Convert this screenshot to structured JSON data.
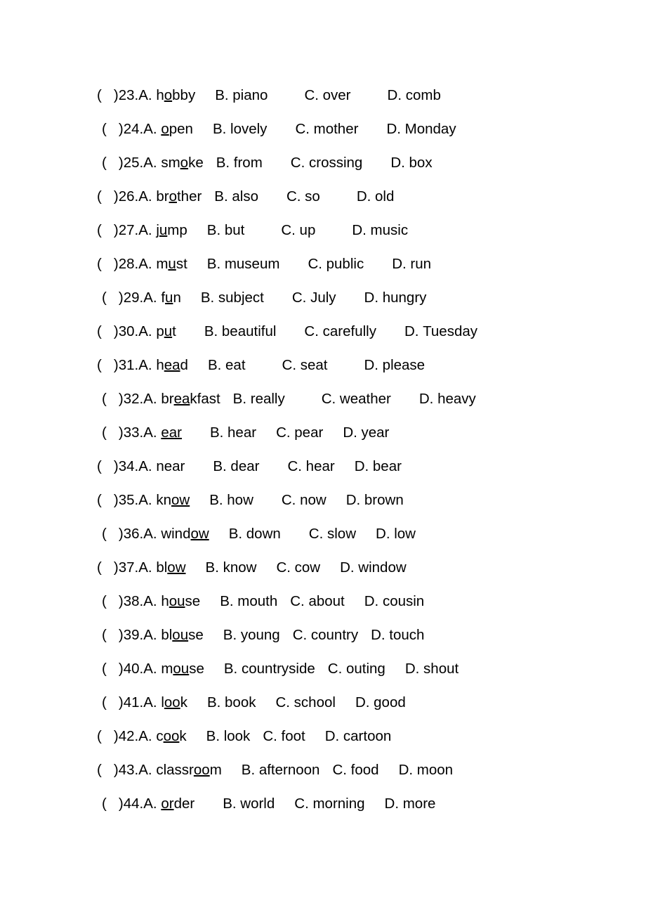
{
  "document": {
    "type": "english-pronunciation-worksheet",
    "bracket_open": "(",
    "bracket_close": ")",
    "option_labels": [
      "A.",
      "B.",
      "C.",
      "D."
    ],
    "questions": [
      {
        "number": "23.",
        "indent": false,
        "a_pre": "h",
        "a_underlined": "o",
        "a_post": "bby",
        "a_full": "hobby",
        "b": "piano",
        "c": "over",
        "d": "comb",
        "gaps": [
          "md",
          "xl",
          "xl"
        ]
      },
      {
        "number": "24.",
        "indent": true,
        "a_pre": "",
        "a_underlined": "o",
        "a_post": "pen",
        "a_full": "open",
        "b": "lovely",
        "c": "mother",
        "d": "Monday",
        "gaps": [
          "md",
          "lg",
          "lg"
        ]
      },
      {
        "number": "25.",
        "indent": true,
        "a_pre": "sm",
        "a_underlined": "o",
        "a_post": "ke",
        "a_full": "smoke",
        "b": "from",
        "c": "crossing",
        "d": "box",
        "gaps": [
          "sm",
          "lg",
          "lg"
        ]
      },
      {
        "number": "26.",
        "indent": false,
        "a_pre": "br",
        "a_underlined": "o",
        "a_post": "ther",
        "a_full": "brother",
        "b": "also",
        "c": "so",
        "d": "old",
        "gaps": [
          "sm",
          "lg",
          "xl"
        ]
      },
      {
        "number": "27.",
        "indent": false,
        "a_pre": "j",
        "a_underlined": "u",
        "a_post": "mp",
        "a_full": "jump",
        "b": "but",
        "c": "up",
        "d": "music",
        "gaps": [
          "md",
          "xl",
          "xl"
        ]
      },
      {
        "number": "28.",
        "indent": false,
        "a_pre": "m",
        "a_underlined": "u",
        "a_post": "st",
        "a_full": "must",
        "b": "museum",
        "c": "public",
        "d": "run",
        "gaps": [
          "md",
          "lg",
          "lg"
        ]
      },
      {
        "number": "29.",
        "indent": true,
        "a_pre": "f",
        "a_underlined": "u",
        "a_post": "n",
        "a_full": "fun",
        "b": "subject",
        "c": "July",
        "d": "hungry",
        "gaps": [
          "md",
          "lg",
          "lg"
        ]
      },
      {
        "number": "30.",
        "indent": false,
        "a_pre": "p",
        "a_underlined": "u",
        "a_post": "t",
        "a_full": "put",
        "b": "beautiful",
        "c": "carefully",
        "d": "Tuesday",
        "gaps": [
          "lg",
          "lg",
          "lg"
        ]
      },
      {
        "number": "31.",
        "indent": false,
        "a_pre": "h",
        "a_underlined": "ea",
        "a_post": "d",
        "a_full": "head",
        "b": "eat",
        "c": "seat",
        "d": "please",
        "gaps": [
          "md",
          "xl",
          "xl"
        ]
      },
      {
        "number": "32.",
        "indent": true,
        "a_pre": "br",
        "a_underlined": "ea",
        "a_post": "kfast",
        "a_full": "breakfast",
        "b": "really",
        "c": "weather",
        "d": "heavy",
        "gaps": [
          "sm",
          "xl",
          "lg"
        ]
      },
      {
        "number": "33.",
        "indent": true,
        "a_pre": "",
        "a_underlined": "ear",
        "a_post": "",
        "a_full": "ear",
        "b": "hear",
        "c": "pear",
        "d": "year",
        "gaps": [
          "lg",
          "md",
          "md"
        ]
      },
      {
        "number": "34.",
        "indent": false,
        "a_pre": "near",
        "a_underlined": "",
        "a_post": "",
        "a_full": "near",
        "b": "dear",
        "c": "hear",
        "d": "bear",
        "gaps": [
          "lg",
          "lg",
          "md"
        ]
      },
      {
        "number": "35.",
        "indent": false,
        "a_pre": "kn",
        "a_underlined": "ow",
        "a_post": "",
        "a_full": "know",
        "b": "how",
        "c": "now",
        "d": "brown",
        "gaps": [
          "md",
          "lg",
          "md"
        ]
      },
      {
        "number": "36.",
        "indent": true,
        "a_pre": "wind",
        "a_underlined": "ow",
        "a_post": "",
        "a_full": "window",
        "b": "down",
        "c": "slow",
        "d": "low",
        "gaps": [
          "md",
          "lg",
          "md"
        ]
      },
      {
        "number": "37.",
        "indent": false,
        "a_pre": "bl",
        "a_underlined": "ow ",
        "a_post": "",
        "a_full": "blow",
        "b": "know",
        "c": "cow",
        "d": "window",
        "gaps": [
          "md",
          "md",
          "md"
        ]
      },
      {
        "number": "38.",
        "indent": true,
        "a_pre": "h",
        "a_underlined": "ou",
        "a_post": "se",
        "a_full": "house",
        "b": "mouth",
        "c": "about",
        "d": "cousin",
        "gaps": [
          "md",
          "sm",
          "md"
        ]
      },
      {
        "number": "39.",
        "indent": true,
        "a_pre": "bl",
        "a_underlined": "ou",
        "a_post": "se",
        "a_full": "blouse",
        "b": "young",
        "c": "country",
        "d": "touch",
        "gaps": [
          "md",
          "sm",
          "sm"
        ]
      },
      {
        "number": "40.",
        "indent": true,
        "a_pre": "m",
        "a_underlined": "ou",
        "a_post": "se",
        "a_full": "mouse",
        "b": "countryside",
        "c": "outing",
        "d": "shout",
        "gaps": [
          "md",
          "xs",
          "md"
        ]
      },
      {
        "number": "41.",
        "indent": true,
        "a_pre": "l",
        "a_underlined": "oo",
        "a_post": "k",
        "a_full": "look",
        "b": "book",
        "c": "school",
        "d": "good",
        "gaps": [
          "md",
          "md",
          "md"
        ]
      },
      {
        "number": "42.",
        "indent": false,
        "a_pre": "c",
        "a_underlined": "oo",
        "a_post": "k",
        "a_full": "cook",
        "b": "look",
        "c": "foot",
        "d": "cartoon",
        "gaps": [
          "md",
          "sm",
          "md"
        ]
      },
      {
        "number": "43.",
        "indent": false,
        "a_pre": "classr",
        "a_underlined": "oo",
        "a_post": "m",
        "a_full": "classroom",
        "b": "afternoon",
        "c": "food",
        "d": "moon",
        "gaps": [
          "md",
          "sm",
          "md"
        ]
      },
      {
        "number": "44.",
        "indent": true,
        "a_pre": "",
        "a_underlined": "or",
        "a_post": "der",
        "a_full": "order",
        "b": "world",
        "c": "morning",
        "d": "more",
        "gaps": [
          "lg",
          "md",
          "md"
        ]
      }
    ]
  }
}
